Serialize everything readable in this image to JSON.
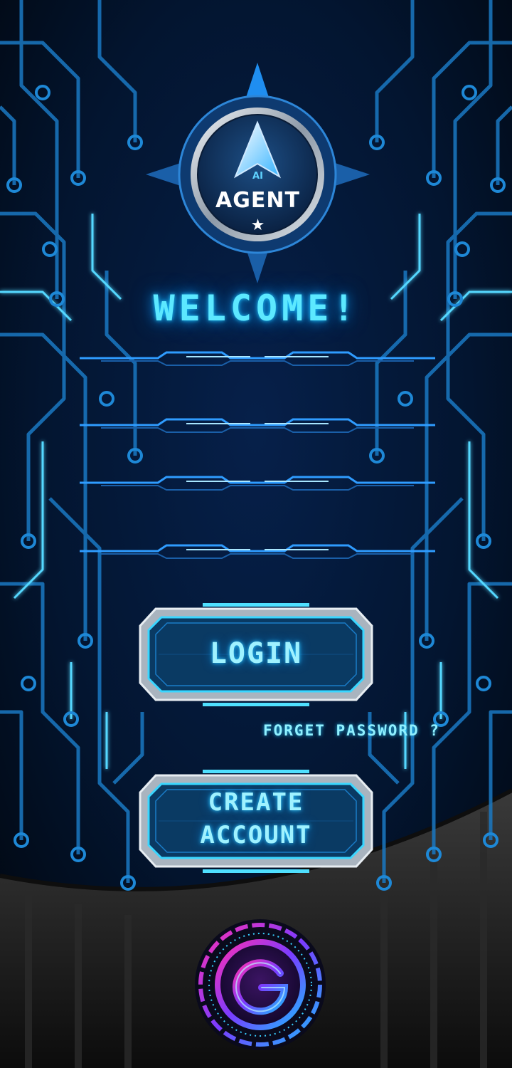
{
  "logo": {
    "ai_label": "AI",
    "brand": "AGENT",
    "star": "★",
    "icon": "compass-logo-icon"
  },
  "welcome": "WELCOME!",
  "form": {
    "fields": [
      {
        "name": "username",
        "value": "",
        "placeholder": ""
      },
      {
        "name": "email",
        "value": "",
        "placeholder": ""
      },
      {
        "name": "password",
        "value": "",
        "placeholder": ""
      },
      {
        "name": "confirm",
        "value": "",
        "placeholder": ""
      }
    ]
  },
  "buttons": {
    "login": "LOGIN",
    "create_line1": "CREATE",
    "create_line2": "ACCOUNT"
  },
  "forgot_password": "FORGET PASSWORD ?",
  "google": {
    "icon": "google-icon",
    "letter": "G"
  },
  "colors": {
    "background": "#020d1f",
    "accent": "#5ce8ff",
    "circuit": "#1a78c2",
    "button_fill": "#0a3a63",
    "button_frame": "#c8d2dc"
  }
}
